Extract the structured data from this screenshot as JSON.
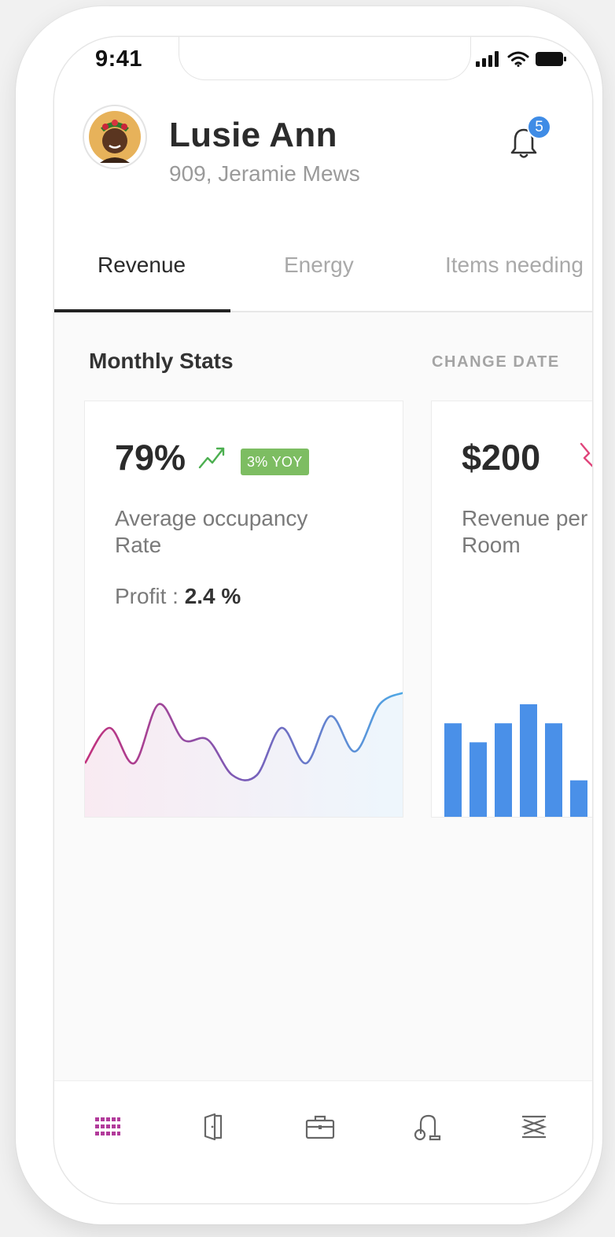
{
  "status_bar": {
    "time": "9:41"
  },
  "user": {
    "name": "Lusie Ann",
    "address": "909, Jeramie Mews"
  },
  "notifications": {
    "count": "5"
  },
  "tabs": [
    {
      "label": "Revenue",
      "active": true
    },
    {
      "label": "Energy",
      "active": false
    },
    {
      "label": "Items needing",
      "active": false
    }
  ],
  "section": {
    "title": "Monthly Stats",
    "action": "CHANGE DATE"
  },
  "cards": [
    {
      "value": "79%",
      "trend": "up",
      "badge": "3% YOY",
      "description": "Average occupancy Rate",
      "profit_label": "Profit : ",
      "profit_value": "2.4 %"
    },
    {
      "value": "$200",
      "trend": "down",
      "description": "Revenue per Room"
    }
  ],
  "chart_data": [
    {
      "type": "area",
      "values": [
        4,
        7,
        4,
        9,
        6,
        6,
        3,
        3,
        7,
        4,
        8,
        5,
        9,
        10
      ],
      "gradient": [
        "#c2317d",
        "#7a5cb8",
        "#4ea9e6"
      ]
    },
    {
      "type": "bar",
      "values": [
        5,
        4,
        5,
        6,
        5,
        2
      ],
      "color": "#4a90e8"
    }
  ],
  "bottom_nav": [
    {
      "icon": "grid-icon",
      "active": true
    },
    {
      "icon": "door-icon",
      "active": false
    },
    {
      "icon": "briefcase-icon",
      "active": false
    },
    {
      "icon": "vacuum-icon",
      "active": false
    },
    {
      "icon": "lift-icon",
      "active": false
    }
  ],
  "colors": {
    "accent": "#3f8ce6",
    "badge_green": "#7dbd62",
    "trend_up": "#4caf50",
    "trend_down": "#e0457b",
    "nav_active": "#b23b9b"
  }
}
